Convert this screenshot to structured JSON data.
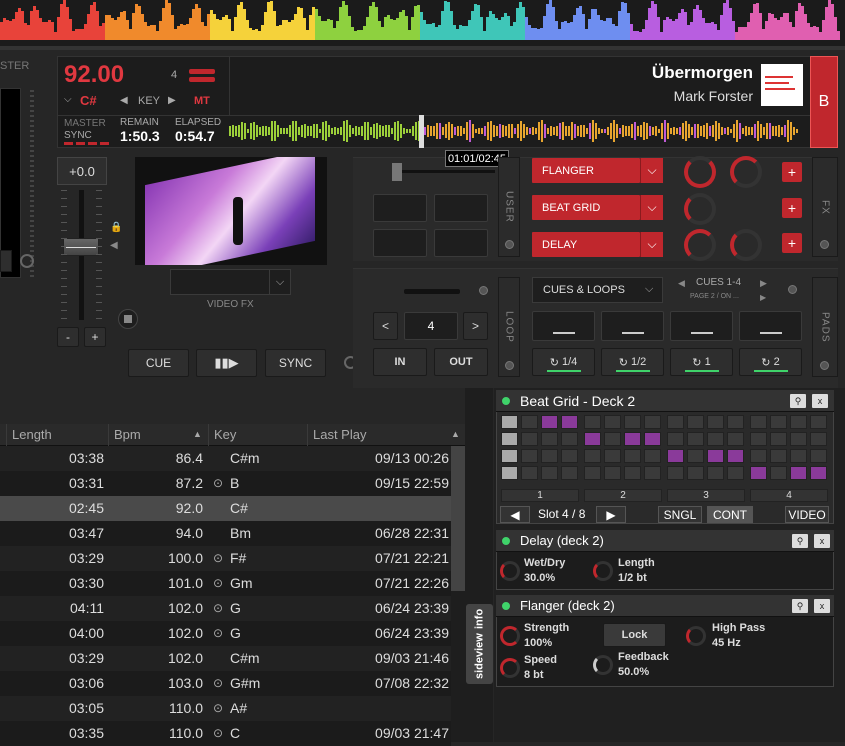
{
  "deck": {
    "master_label_left": "STER",
    "bpm": "92.00",
    "key": "C#",
    "key_label": "KEY",
    "mt": "MT",
    "beat_count": "4",
    "title": "Übermorgen",
    "artist": "Mark Forster",
    "deck_letter": "B",
    "master": "MASTER",
    "sync": "SYNC",
    "remain_label": "REMAIN",
    "remain": "1:50.3",
    "elapsed_label": "ELAPSED",
    "elapsed": "0:54.7",
    "time_tooltip": "01:01/02:45",
    "pitch": "+0.0",
    "video_fx": "VIDEO FX",
    "cue": "CUE",
    "sync_btn": "SYNC",
    "minus": "-",
    "plus": "+"
  },
  "fx": {
    "user_tab": "USER",
    "fx_tab": "FX",
    "effects": [
      "FLANGER",
      "BEAT GRID",
      "DELAY"
    ],
    "plus": "+"
  },
  "loop": {
    "loop_tab": "LOOP",
    "pads_tab": "PADS",
    "loop_size": "4",
    "in": "IN",
    "out": "OUT",
    "pad_mode": "CUES & LOOPS",
    "cues_page": "CUES 1-4",
    "page_sub": "PAGE 2 / ON ...",
    "loop_buttons": [
      "1/4",
      "1/2",
      "1",
      "2"
    ]
  },
  "browser": {
    "columns": [
      "Length",
      "Bpm",
      "Key",
      "Last Play"
    ],
    "rows": [
      {
        "length": "03:38",
        "bpm": "86.4",
        "key": "C#m",
        "check": false,
        "last": "09/13 00:26"
      },
      {
        "length": "03:31",
        "bpm": "87.2",
        "key": "B",
        "check": true,
        "last": "09/15 22:59"
      },
      {
        "length": "02:45",
        "bpm": "92.0",
        "key": "C#",
        "check": false,
        "last": ""
      },
      {
        "length": "03:47",
        "bpm": "94.0",
        "key": "Bm",
        "check": false,
        "last": "06/28 22:31"
      },
      {
        "length": "03:29",
        "bpm": "100.0",
        "key": "F#",
        "check": true,
        "last": "07/21 22:21"
      },
      {
        "length": "03:30",
        "bpm": "101.0",
        "key": "Gm",
        "check": true,
        "last": "07/21 22:26"
      },
      {
        "length": "04:11",
        "bpm": "102.0",
        "key": "G",
        "check": true,
        "last": "06/24 23:39"
      },
      {
        "length": "04:00",
        "bpm": "102.0",
        "key": "G",
        "check": true,
        "last": "06/24 23:39"
      },
      {
        "length": "03:29",
        "bpm": "102.0",
        "key": "C#m",
        "check": false,
        "last": "09/03 21:46"
      },
      {
        "length": "03:06",
        "bpm": "103.0",
        "key": "G#m",
        "check": true,
        "last": "07/08 22:32"
      },
      {
        "length": "03:05",
        "bpm": "110.0",
        "key": "A#",
        "check": true,
        "last": ""
      },
      {
        "length": "03:35",
        "bpm": "110.0",
        "key": "C",
        "check": true,
        "last": "09/03 21:47"
      }
    ],
    "sideview": "sideview",
    "info": "info"
  },
  "beatgrid": {
    "title": "Beat Grid - Deck 2",
    "groups": [
      "1",
      "2",
      "3",
      "4"
    ],
    "slot": "Slot 4 / 8",
    "sngl": "SNGL",
    "cont": "CONT",
    "video": "VIDEO"
  },
  "delay": {
    "title": "Delay (deck 2)",
    "wetdry_label": "Wet/Dry",
    "wetdry": "30.0%",
    "length_label": "Length",
    "length": "1/2 bt"
  },
  "flanger": {
    "title": "Flanger (deck 2)",
    "strength_label": "Strength",
    "strength": "100%",
    "lock": "Lock",
    "highpass_label": "High Pass",
    "highpass": "45 Hz",
    "speed_label": "Speed",
    "speed": "8 bt",
    "feedback_label": "Feedback",
    "feedback": "50.0%"
  },
  "panel_buttons": {
    "pin": "📌",
    "close": "x"
  },
  "colors": {
    "accent": "#c0272d",
    "green": "#3fd36a",
    "purple": "#8a3a9a"
  }
}
